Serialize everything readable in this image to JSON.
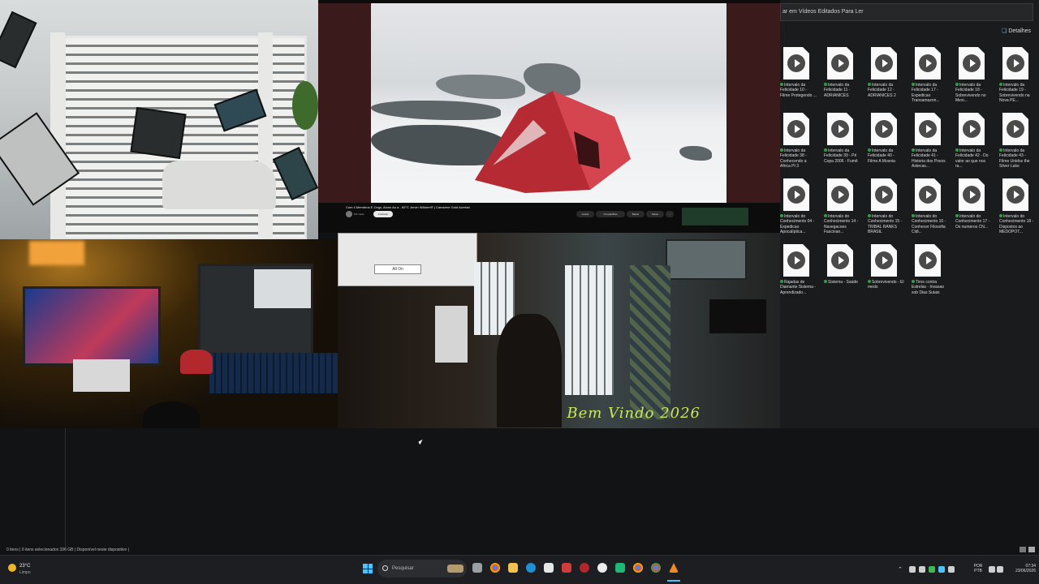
{
  "video": {
    "title": "Com 4 Membros E Cego, Aluno Ao a - 60°C Jervin Währen® | Camarme Gold Acertad",
    "channel": "MX caras",
    "subscribe_label": "Inscrever",
    "actions": [
      "Gostei",
      "Compartilhar",
      "Baixar",
      "Salvar",
      "..."
    ]
  },
  "popup": {
    "button_label": "All On"
  },
  "overlay": {
    "welcome_text": "Bem Vindo 2026"
  },
  "file_pane": {
    "search_text": "ar em Vídeos Editados Para Ler",
    "details_label": "Detalhes",
    "files": [
      "Intervalo da Felicidade 10 - Filme Protegendo ...",
      "Intervalo da Felicidade 11 - ADRIANICES",
      "Intervalo da Felicidade 12 - ADRIANICES 2",
      "Intervalo da Felicidade 17 - Expedicao Transamazon...",
      "Intervalo da Felicidade 18 - Sobrevivendo no Mexi...",
      "Intervalo da Felicidade 19 - Sobrevivendo na Nova PE...",
      "Intervalo da Felicidade 38 - Conhecendo a Africa Pt 3",
      "Intervalo da Felicidade 39 - Pé Copa 2006 - Fumê",
      "Intervalo da Felicidade 40 - Filme A Mosnia",
      "Intervalo da Felicidade 41 - Historia dos Povos Astecas...",
      "Intervalo da Felicidade 42 - Do valor ao que nos ra...",
      "Intervalo da Felicidade 43 - Filme Unidos the Silver Lake",
      "Intervalo do Conhecimento 04 - Expedicao Apocalíptica...",
      "Intervalo do Conhecimento 14 - Navegacoes Fascinan...",
      "Intervalo do Conhecimento 15 - TRIBAL RANKS BRASIL",
      "Intervalo do Conhecimento 16 - Conhecer Filosofia Cidi...",
      "Intervalo do Conhecimento 17 - Os numeros CN...",
      "Intervalo do Conhecimento 18 - Dispostos ao MEDOPOT...",
      "Rajadas de Diamante Sistema - Aprendizado...",
      "Sistema - Saúde",
      "Sobrevivendo - El medo",
      "Tiros contra Estrelas - Invasao sob Dias Suiais"
    ]
  },
  "status_bar": {
    "text": "0 itens  |  0 itens selecionados  336 GB  |  Disponível neste dispositivo  |"
  },
  "taskbar": {
    "weather_temp": "23°C",
    "weather_desc": "Limpo",
    "search_placeholder": "Pesquisar",
    "lang_line1": "POR",
    "lang_line2": "PTB",
    "time": "07:34",
    "date": "23/06/2026"
  },
  "colors": {
    "accent": "#4cc2ff",
    "welcome": "#c9e85c",
    "tent": "#c0323a"
  }
}
